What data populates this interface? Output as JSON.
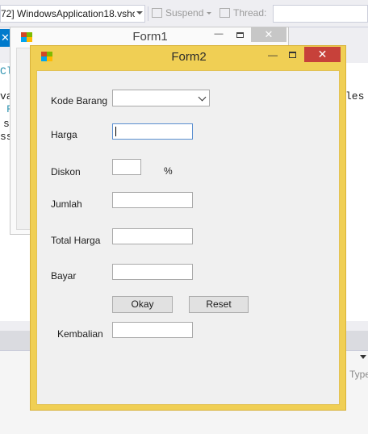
{
  "ide": {
    "project_combo": "72] WindowsApplication18.vshc",
    "suspend_label": "Suspend",
    "thread_label": "Thread:",
    "code_fragments": [
      "Cl",
      "va",
      "F",
      "s",
      "ss",
      "les"
    ],
    "type_label": "Type"
  },
  "form1": {
    "title": "Form1",
    "min_glyph": "—",
    "close_glyph": "✕"
  },
  "form2": {
    "title": "Form2",
    "min_glyph": "—",
    "close_glyph": "✕",
    "fields": {
      "kode_barang_label": "Kode Barang",
      "kode_barang_value": "",
      "harga_label": "Harga",
      "harga_value": "",
      "diskon_label": "Diskon",
      "diskon_value": "",
      "percent_sign": "%",
      "jumlah_label": "Jumlah",
      "jumlah_value": "",
      "total_harga_label": "Total Harga",
      "total_harga_value": "",
      "bayar_label": "Bayar",
      "bayar_value": "",
      "kembalian_label": "Kembalian",
      "kembalian_value": ""
    },
    "buttons": {
      "okay_label": "Okay",
      "reset_label": "Reset"
    }
  }
}
